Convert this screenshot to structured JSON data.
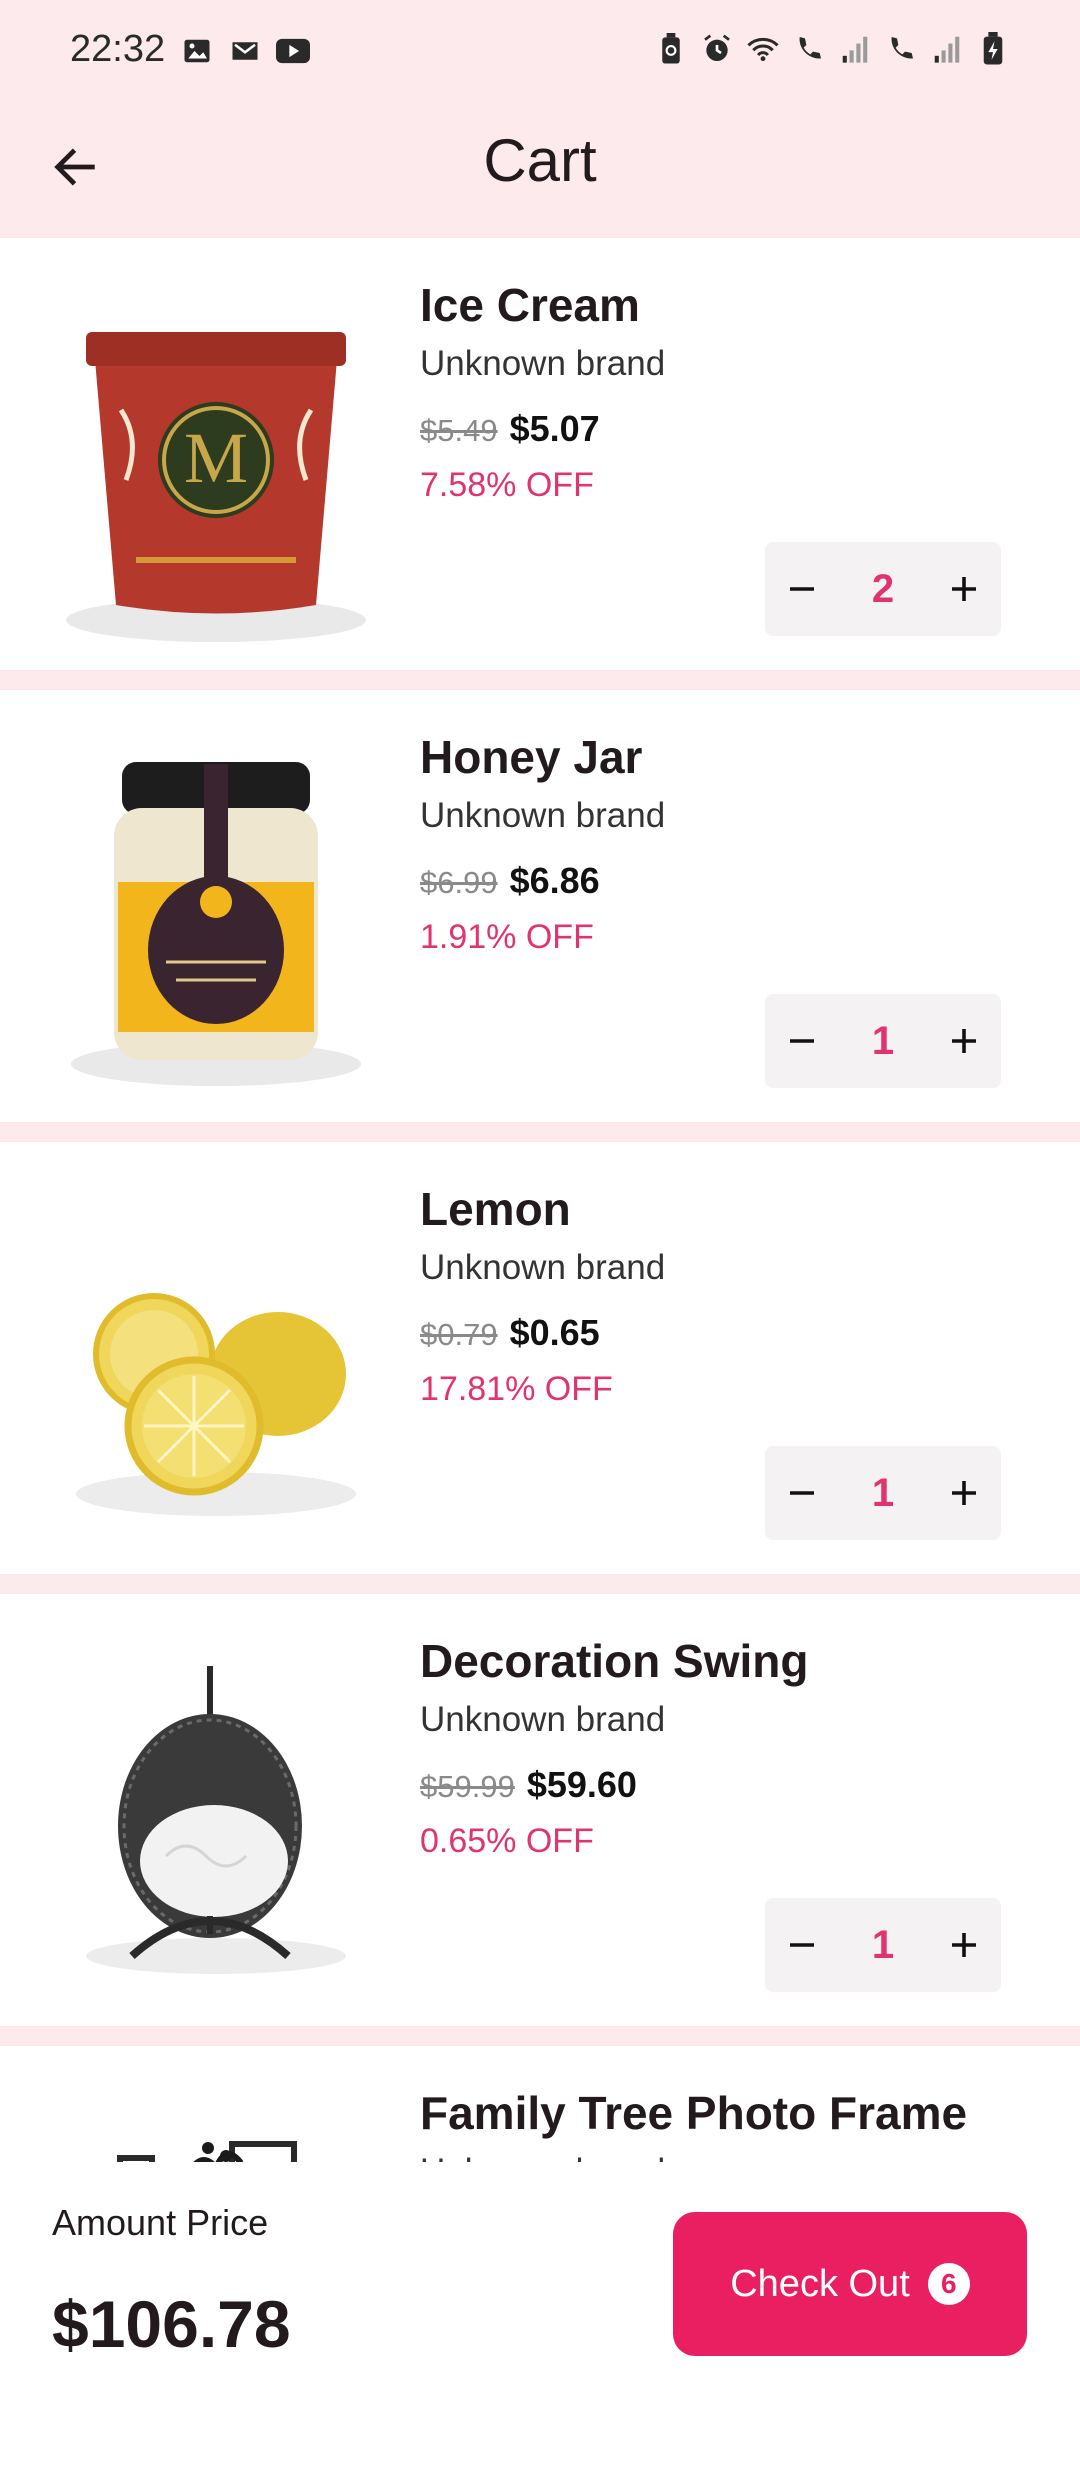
{
  "status_bar": {
    "time": "22:32",
    "left_icons": [
      "image-icon",
      "mail-icon",
      "youtube-icon"
    ],
    "right_icons": [
      "battery-saver-icon",
      "alarm-icon",
      "wifi-icon",
      "call-sim1-icon",
      "signal-1-icon",
      "call-sim2-icon",
      "signal-2-icon",
      "battery-charging-icon"
    ]
  },
  "app_bar": {
    "title": "Cart",
    "back_icon": "arrow-left-icon"
  },
  "items": [
    {
      "name": "Ice Cream",
      "brand": "Unknown brand",
      "old_price": "$5.49",
      "new_price": "$5.07",
      "discount": "7.58% OFF",
      "quantity": "2"
    },
    {
      "name": "Honey Jar",
      "brand": "Unknown brand",
      "old_price": "$6.99",
      "new_price": "$6.86",
      "discount": "1.91% OFF",
      "quantity": "1"
    },
    {
      "name": "Lemon",
      "brand": "Unknown brand",
      "old_price": "$0.79",
      "new_price": "$0.65",
      "discount": "17.81% OFF",
      "quantity": "1"
    },
    {
      "name": "Decoration Swing",
      "brand": "Unknown brand",
      "old_price": "$59.99",
      "new_price": "$59.60",
      "discount": "0.65% OFF",
      "quantity": "1"
    },
    {
      "name": "Family Tree Photo Frame",
      "brand": "Unknown brand"
    }
  ],
  "bottom_bar": {
    "amount_label": "Amount Price",
    "amount_value": "$106.78",
    "checkout_label": "Check Out",
    "checkout_count": "6"
  },
  "colors": {
    "accent": "#ea1f62",
    "discount_text": "#e0336f",
    "header_bg": "#fdeaed",
    "stepper_bg": "#f4f2f3"
  }
}
